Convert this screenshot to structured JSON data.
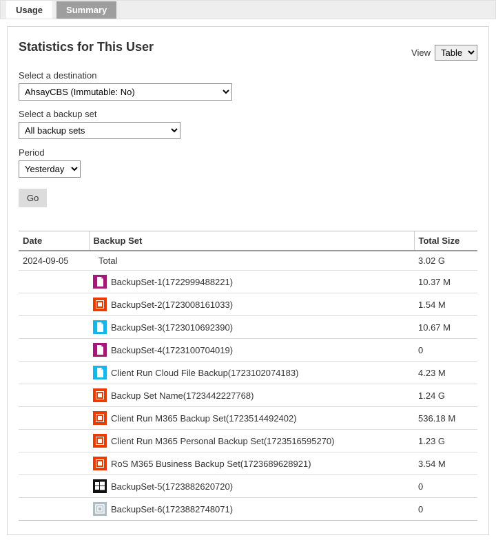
{
  "tabs": {
    "usage": "Usage",
    "summary": "Summary"
  },
  "panel_title": "Statistics for This User",
  "view": {
    "label": "View",
    "value": "Table",
    "options": [
      "Table"
    ]
  },
  "filters": {
    "destination": {
      "label": "Select a destination",
      "value": "AhsayCBS (Immutable: No)"
    },
    "backupset": {
      "label": "Select a backup set",
      "value": "All backup sets"
    },
    "period": {
      "label": "Period",
      "value": "Yesterday"
    }
  },
  "go_label": "Go",
  "table": {
    "headers": {
      "date": "Date",
      "set": "Backup Set",
      "size": "Total Size"
    },
    "date": "2024-09-05",
    "total_label": "Total",
    "total_size": "3.02 G",
    "rows": [
      {
        "icon": "file-magenta",
        "name": "BackupSet-1(1722999488221)",
        "size": "10.37 M"
      },
      {
        "icon": "office-orange",
        "name": "BackupSet-2(1723008161033)",
        "size": "1.54 M"
      },
      {
        "icon": "file-cyan",
        "name": "BackupSet-3(1723010692390)",
        "size": "10.67 M"
      },
      {
        "icon": "file-magenta",
        "name": "BackupSet-4(1723100704019)",
        "size": "0"
      },
      {
        "icon": "file-cyan",
        "name": "Client Run Cloud File Backup(1723102074183)",
        "size": "4.23 M"
      },
      {
        "icon": "office-orange",
        "name": "Backup Set Name(1723442227768)",
        "size": "1.24 G"
      },
      {
        "icon": "office-orange",
        "name": "Client Run M365 Backup Set(1723514492402)",
        "size": "536.18 M"
      },
      {
        "icon": "office-orange",
        "name": "Client Run M365 Personal Backup Set(1723516595270)",
        "size": "1.23 G"
      },
      {
        "icon": "office-orange",
        "name": "RoS M365 Business Backup Set(1723689628921)",
        "size": "3.54 M"
      },
      {
        "icon": "windows-black",
        "name": "BackupSet-5(1723882620720)",
        "size": "0"
      },
      {
        "icon": "vm-grey",
        "name": "BackupSet-6(1723882748071)",
        "size": "0"
      }
    ]
  },
  "icons": {
    "file-magenta": {
      "bg": "#a6177a",
      "type": "file"
    },
    "office-orange": {
      "bg": "#ea3b00",
      "type": "office"
    },
    "file-cyan": {
      "bg": "#19b5e6",
      "type": "file"
    },
    "windows-black": {
      "bg": "#111111",
      "type": "windows"
    },
    "vm-grey": {
      "bg": "#aebdc4",
      "type": "vm"
    }
  }
}
